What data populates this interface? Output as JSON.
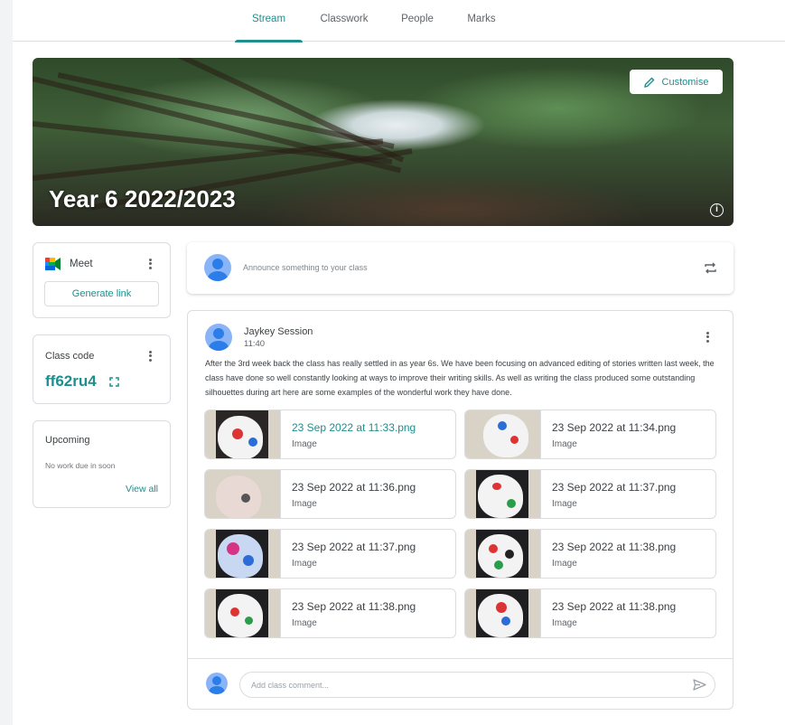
{
  "tabs": [
    {
      "label": "Stream",
      "active": true
    },
    {
      "label": "Classwork",
      "active": false
    },
    {
      "label": "People",
      "active": false
    },
    {
      "label": "Marks",
      "active": false
    }
  ],
  "banner": {
    "title": "Year 6 2022/2023",
    "customise_label": "Customise",
    "info_icon": "info-icon"
  },
  "meet": {
    "label": "Meet",
    "generate_label": "Generate link"
  },
  "class_code": {
    "label": "Class code",
    "value": "ff62ru4"
  },
  "upcoming": {
    "label": "Upcoming",
    "empty_text": "No work due in soon",
    "view_all": "View all"
  },
  "announce": {
    "placeholder": "Announce something to your class"
  },
  "post": {
    "author": "Jaykey Session",
    "time": "11:40",
    "body": "After the 3rd week back the class has really settled in as year 6s. We have been focusing on advanced editing of stories written last week, the class have done so well constantly looking at ways to improve their writing skills. As well as writing the class produced some outstanding silhouettes during art here are some examples of the wonderful work they have done.",
    "attachments": [
      {
        "title": "23 Sep 2022 at 11:33.png",
        "type": "Image"
      },
      {
        "title": "23 Sep 2022 at 11:34.png",
        "type": "Image"
      },
      {
        "title": "23 Sep 2022 at 11:36.png",
        "type": "Image"
      },
      {
        "title": "23 Sep 2022 at 11:37.png",
        "type": "Image"
      },
      {
        "title": "23 Sep 2022 at 11:37.png",
        "type": "Image"
      },
      {
        "title": "23 Sep 2022 at 11:38.png",
        "type": "Image"
      },
      {
        "title": "23 Sep 2022 at 11:38.png",
        "type": "Image"
      },
      {
        "title": "23 Sep 2022 at 11:38.png",
        "type": "Image"
      }
    ],
    "comment_placeholder": "Add class comment..."
  },
  "colors": {
    "accent": "#1e8e8e",
    "avatar": "#8ab4f8",
    "border": "#dadce0"
  }
}
